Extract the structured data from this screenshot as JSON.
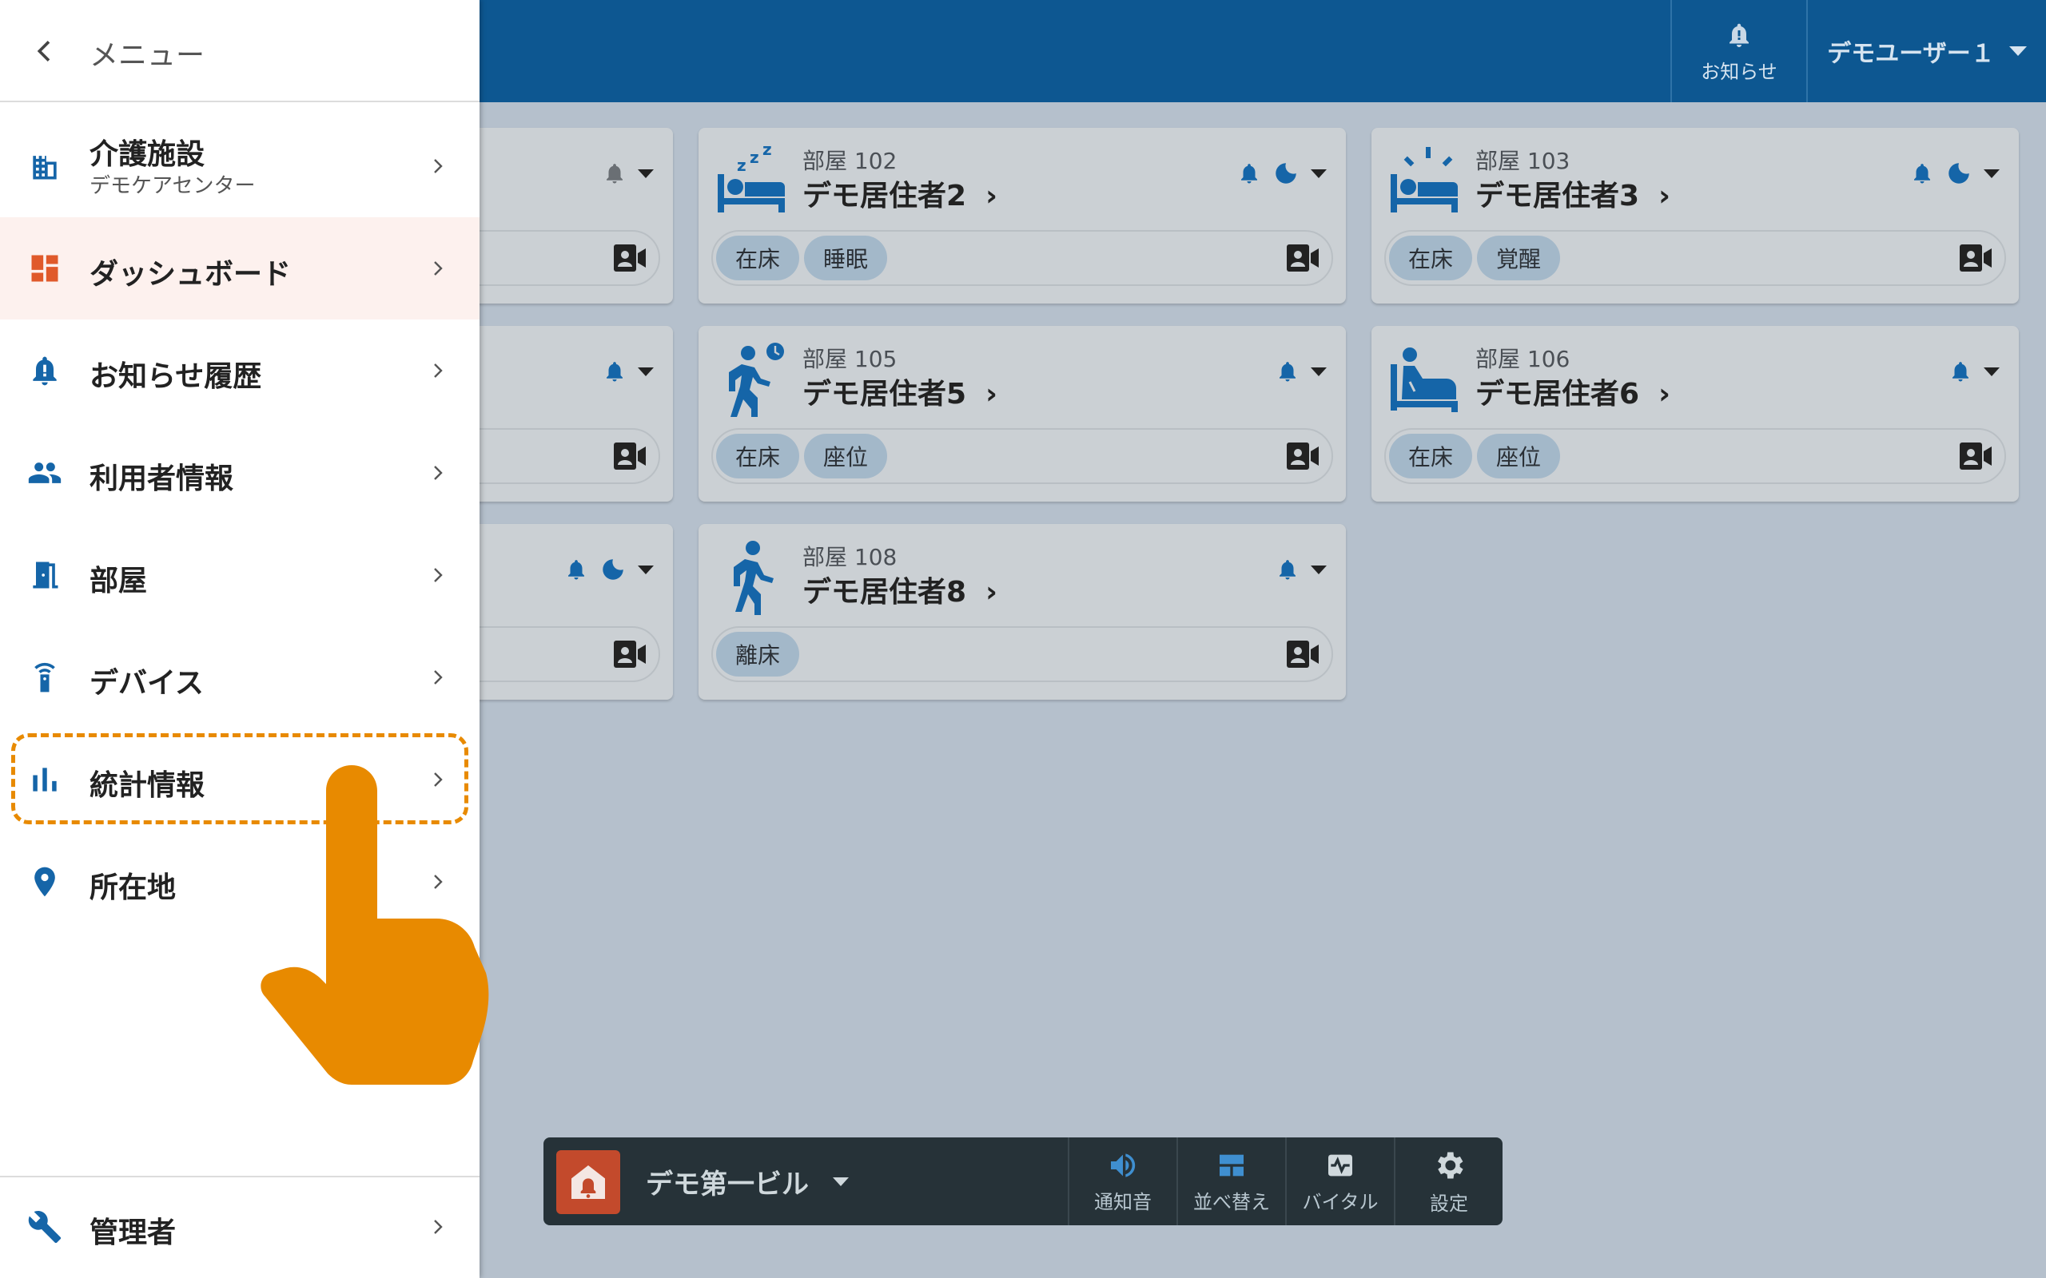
{
  "header": {
    "notify_label": "お知らせ",
    "user_name": "デモユーザー１"
  },
  "cards": [
    {
      "room": "",
      "resident": "",
      "chips": [],
      "icons": [
        "bell-icon"
      ],
      "hidden_behind_drawer": true
    },
    {
      "room": "部屋 102",
      "resident": "デモ居住者2",
      "chips": [
        "在床",
        "睡眠"
      ],
      "state_icon": "sleeping-bed-icon",
      "icons": [
        "bell-icon",
        "moon-icon"
      ]
    },
    {
      "room": "部屋 103",
      "resident": "デモ居住者3",
      "chips": [
        "在床",
        "覚醒"
      ],
      "state_icon": "awake-bed-icon",
      "icons": [
        "bell-icon",
        "moon-icon"
      ]
    },
    {
      "room": "",
      "resident": "",
      "chips": [],
      "icons": [
        "bell-icon"
      ],
      "hidden_behind_drawer": true
    },
    {
      "room": "部屋 105",
      "resident": "デモ居住者5",
      "chips": [
        "在床",
        "座位"
      ],
      "state_icon": "walking-clock-icon",
      "icons": [
        "bell-icon"
      ]
    },
    {
      "room": "部屋 106",
      "resident": "デモ居住者6",
      "chips": [
        "在床",
        "座位"
      ],
      "state_icon": "sitting-bed-icon",
      "icons": [
        "bell-icon"
      ]
    },
    {
      "room": "",
      "resident": "",
      "chips": [],
      "icons": [
        "bell-icon",
        "moon-icon"
      ],
      "hidden_behind_drawer": true
    },
    {
      "room": "部屋 108",
      "resident": "デモ居住者8",
      "chips": [
        "離床"
      ],
      "state_icon": "walking-icon",
      "icons": [
        "bell-icon"
      ]
    }
  ],
  "toolbar": {
    "building": "デモ第一ビル",
    "buttons": [
      {
        "label": "通知音",
        "icon": "speaker-icon"
      },
      {
        "label": "並べ替え",
        "icon": "layout-icon"
      },
      {
        "label": "バイタル",
        "icon": "vitals-icon"
      },
      {
        "label": "設定",
        "icon": "gear-icon"
      }
    ]
  },
  "drawer": {
    "title": "メニュー",
    "items": [
      {
        "label": "介護施設",
        "sub": "デモケアセンター",
        "icon": "building-icon"
      },
      {
        "label": "ダッシュボード",
        "icon": "dashboard-icon",
        "active": true
      },
      {
        "label": "お知らせ履歴",
        "icon": "bell-alert-icon"
      },
      {
        "label": "利用者情報",
        "icon": "people-icon"
      },
      {
        "label": "部屋",
        "icon": "door-icon"
      },
      {
        "label": "デバイス",
        "icon": "sensor-icon"
      },
      {
        "label": "統計情報",
        "icon": "bar-chart-icon",
        "highlighted": true
      },
      {
        "label": "所在地",
        "icon": "location-pin-icon"
      }
    ],
    "footer_item": {
      "label": "管理者",
      "icon": "wrench-icon"
    }
  },
  "colors": {
    "topbar": "#0d5791",
    "accent_blue": "#1565a8",
    "highlight": "#e88a00",
    "active_item_bg": "#fdf1ee",
    "dashboard_icon": "#e05a2b",
    "toolbar_bg": "#263238"
  }
}
